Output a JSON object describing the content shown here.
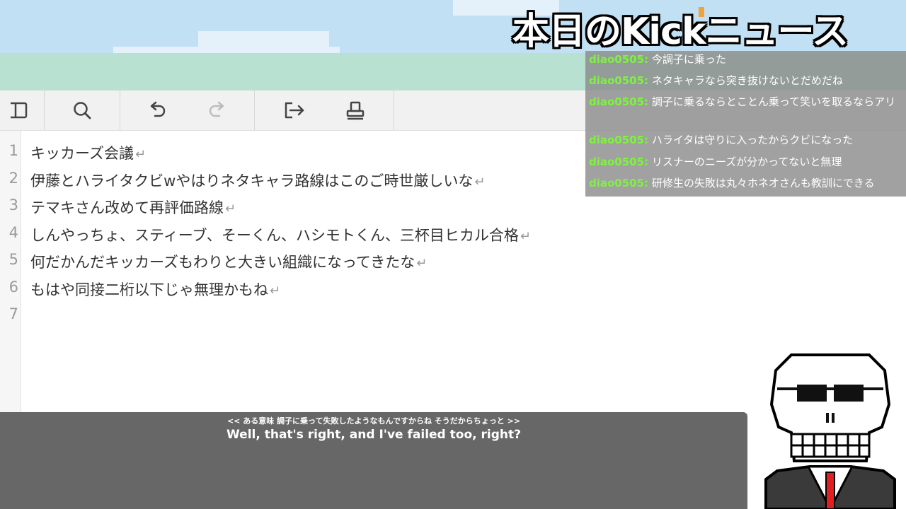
{
  "title": "本日のKickニュース",
  "toolbar": {
    "icons": [
      "sidebar-icon",
      "search-icon",
      "undo-icon",
      "redo-icon",
      "export-icon",
      "print-icon"
    ]
  },
  "editor": {
    "lines": [
      {
        "num": "1",
        "text": "キッカーズ会議"
      },
      {
        "num": "2",
        "text": "伊藤とハライタクビwやはりネタキャラ路線はこのご時世厳しいな"
      },
      {
        "num": "3",
        "text": "テマキさん改めて再評価路線"
      },
      {
        "num": "4",
        "text": "しんやっちょ、スティーブ、そーくん、ハシモトくん、三杯目ヒカル合格"
      },
      {
        "num": "5",
        "text": "何だかんだキッカーズもわりと大きい組織になってきたな"
      },
      {
        "num": "6",
        "text": "もはや同接二桁以下じゃ無理かもね"
      },
      {
        "num": "7",
        "text": ""
      }
    ],
    "return_mark": "↵"
  },
  "chat": {
    "messages": [
      {
        "user": "diao0505:",
        "text": "今調子に乗った"
      },
      {
        "user": "diao0505:",
        "text": "ネタキャラなら突き抜けないとだめだね"
      },
      {
        "user": "diao0505:",
        "text": "調子に乗るならとことん乗って笑いを取るならアリ"
      },
      {
        "user": "diao0505:",
        "text": "ハライタは守りに入ったからクビになった"
      },
      {
        "user": "diao0505:",
        "text": "リスナーのニーズが分かってないと無理"
      },
      {
        "user": "diao0505:",
        "text": "研修生の失敗は丸々ホネオさんも教訓にできる"
      }
    ],
    "user_color": "#7ef33f"
  },
  "subtitle": {
    "original": "<< ある意味 調子に乗って失敗したようなもんですからね そうだからちょっと >>",
    "translation": "Well, that's right, and I've failed too, right?"
  }
}
